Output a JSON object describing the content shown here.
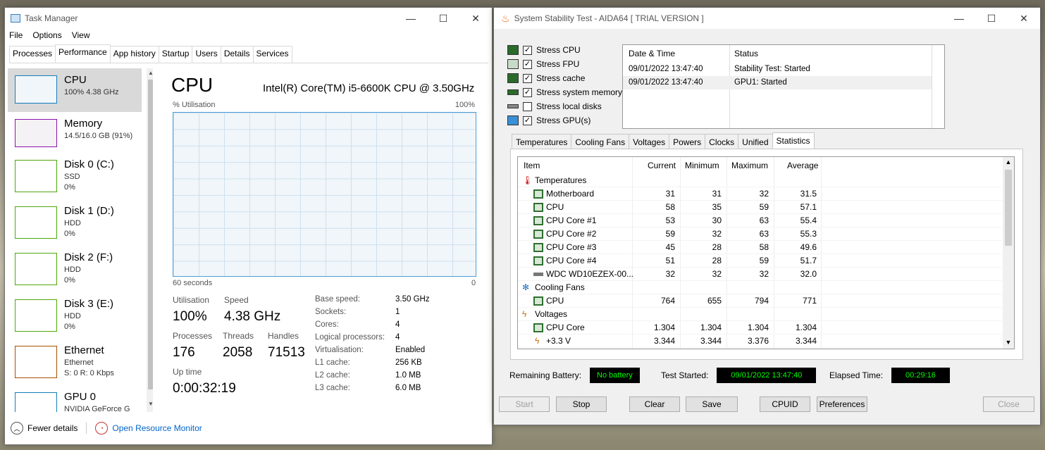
{
  "taskmgr": {
    "title": "Task Manager",
    "menu": [
      "File",
      "Options",
      "View"
    ],
    "tabs": [
      "Processes",
      "Performance",
      "App history",
      "Startup",
      "Users",
      "Details",
      "Services"
    ],
    "sidebar": [
      {
        "name": "CPU",
        "sub1": "100% 4.38 GHz",
        "sub2": "",
        "color": "#117dbb"
      },
      {
        "name": "Memory",
        "sub1": "14.5/16.0 GB (91%)",
        "sub2": "",
        "color": "#8b12ae"
      },
      {
        "name": "Disk 0 (C:)",
        "sub1": "SSD",
        "sub2": "0%",
        "color": "#4da60c"
      },
      {
        "name": "Disk 1 (D:)",
        "sub1": "HDD",
        "sub2": "0%",
        "color": "#4da60c"
      },
      {
        "name": "Disk 2 (F:)",
        "sub1": "HDD",
        "sub2": "0%",
        "color": "#4da60c"
      },
      {
        "name": "Disk 3 (E:)",
        "sub1": "HDD",
        "sub2": "0%",
        "color": "#4da60c"
      },
      {
        "name": "Ethernet",
        "sub1": "Ethernet",
        "sub2": "S: 0 R: 0 Kbps",
        "color": "#a74f01"
      },
      {
        "name": "GPU 0",
        "sub1": "NVIDIA GeForce G",
        "sub2": "",
        "color": "#117dbb"
      }
    ],
    "main_title": "CPU",
    "cpu_model": "Intel(R) Core(TM) i5-6600K CPU @ 3.50GHz",
    "util_label": "% Utilisation",
    "util_max": "100%",
    "time_span": "60 seconds",
    "zero": "0",
    "stats": {
      "utilisation_label": "Utilisation",
      "utilisation": "100%",
      "speed_label": "Speed",
      "speed": "4.38 GHz",
      "processes_label": "Processes",
      "processes": "176",
      "threads_label": "Threads",
      "threads": "2058",
      "handles_label": "Handles",
      "handles": "71513",
      "uptime_label": "Up time",
      "uptime": "0:00:32:19"
    },
    "details": [
      {
        "k": "Base speed:",
        "v": "3.50 GHz"
      },
      {
        "k": "Sockets:",
        "v": "1"
      },
      {
        "k": "Cores:",
        "v": "4"
      },
      {
        "k": "Logical processors:",
        "v": "4"
      },
      {
        "k": "Virtualisation:",
        "v": "Enabled"
      },
      {
        "k": "L1 cache:",
        "v": "256 KB"
      },
      {
        "k": "L2 cache:",
        "v": "1.0 MB"
      },
      {
        "k": "L3 cache:",
        "v": "6.0 MB"
      }
    ],
    "fewer_details": "Fewer details",
    "open_resource_monitor": "Open Resource Monitor"
  },
  "aida": {
    "title": "System Stability Test - AIDA64  [ TRIAL VERSION ]",
    "checks": [
      {
        "label": "Stress CPU",
        "checked": "✓"
      },
      {
        "label": "Stress FPU",
        "checked": "✓"
      },
      {
        "label": "Stress cache",
        "checked": "✓"
      },
      {
        "label": "Stress system memory",
        "checked": "✓"
      },
      {
        "label": "Stress local disks",
        "checked": ""
      },
      {
        "label": "Stress GPU(s)",
        "checked": "✓"
      }
    ],
    "log_headers": {
      "date": "Date & Time",
      "status": "Status"
    },
    "log": [
      {
        "date": "09/01/2022 13:47:40",
        "status": "Stability Test: Started"
      },
      {
        "date": "09/01/2022 13:47:40",
        "status": "GPU1: Started"
      }
    ],
    "tabs": [
      "Temperatures",
      "Cooling Fans",
      "Voltages",
      "Powers",
      "Clocks",
      "Unified",
      "Statistics"
    ],
    "table_headers": {
      "item": "Item",
      "current": "Current",
      "minimum": "Minimum",
      "maximum": "Maximum",
      "average": "Average"
    },
    "rows": [
      {
        "group": "Temperatures"
      },
      {
        "item": "Motherboard",
        "current": "31",
        "minimum": "31",
        "maximum": "32",
        "average": "31.5"
      },
      {
        "item": "CPU",
        "current": "58",
        "minimum": "35",
        "maximum": "59",
        "average": "57.1"
      },
      {
        "item": "CPU Core #1",
        "current": "53",
        "minimum": "30",
        "maximum": "63",
        "average": "55.4"
      },
      {
        "item": "CPU Core #2",
        "current": "59",
        "minimum": "32",
        "maximum": "63",
        "average": "55.3"
      },
      {
        "item": "CPU Core #3",
        "current": "45",
        "minimum": "28",
        "maximum": "58",
        "average": "49.6"
      },
      {
        "item": "CPU Core #4",
        "current": "51",
        "minimum": "28",
        "maximum": "59",
        "average": "51.7"
      },
      {
        "item": "WDC WD10EZEX-00...",
        "current": "32",
        "minimum": "32",
        "maximum": "32",
        "average": "32.0"
      },
      {
        "group": "Cooling Fans"
      },
      {
        "item": "CPU",
        "current": "764",
        "minimum": "655",
        "maximum": "794",
        "average": "771"
      },
      {
        "group": "Voltages"
      },
      {
        "item": "CPU Core",
        "current": "1.304",
        "minimum": "1.304",
        "maximum": "1.304",
        "average": "1.304"
      },
      {
        "item": "+3.3 V",
        "current": "3.344",
        "minimum": "3.344",
        "maximum": "3.376",
        "average": "3.344"
      }
    ],
    "battery_label": "Remaining Battery:",
    "battery": "No battery",
    "started_label": "Test Started:",
    "started": "09/01/2022 13:47:40",
    "elapsed_label": "Elapsed Time:",
    "elapsed": "00:29:16",
    "buttons": {
      "start": "Start",
      "stop": "Stop",
      "clear": "Clear",
      "save": "Save",
      "cpuid": "CPUID",
      "prefs": "Preferences",
      "close": "Close"
    }
  }
}
